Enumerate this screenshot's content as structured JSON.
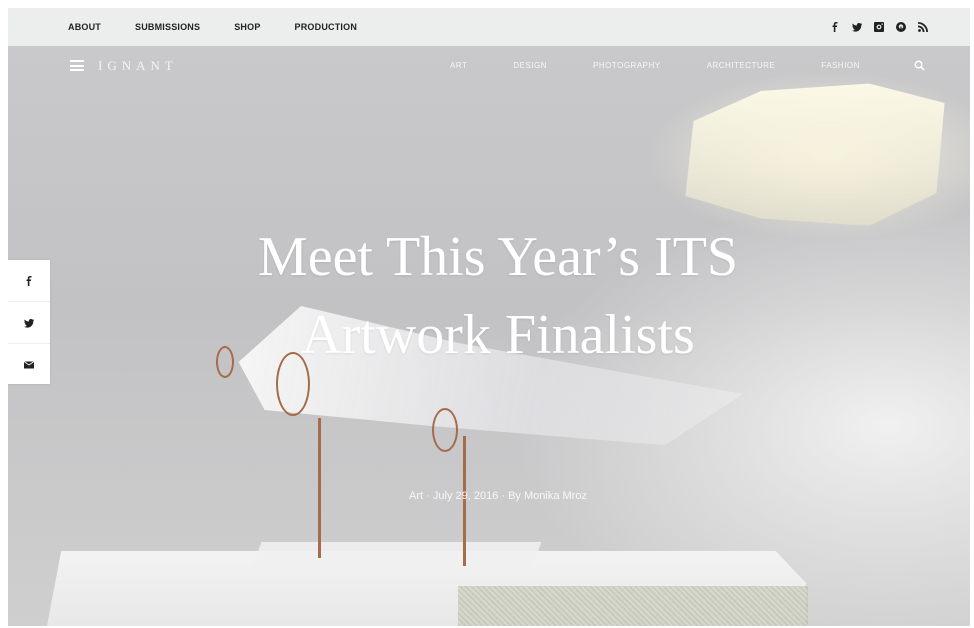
{
  "topbar": {
    "nav": [
      "ABOUT",
      "SUBMISSIONS",
      "SHOP",
      "PRODUCTION"
    ],
    "social_icons": [
      "facebook-icon",
      "twitter-icon",
      "instagram-icon",
      "pinterest-icon",
      "rss-icon"
    ]
  },
  "header": {
    "logo": "IGNANT",
    "categories": [
      "ART",
      "DESIGN",
      "PHOTOGRAPHY",
      "ARCHITECTURE",
      "FASHION"
    ],
    "search_icon": "search-icon",
    "menu_icon": "hamburger-icon"
  },
  "article": {
    "title": "Meet This Year’s ITS Artwork Finalists",
    "meta": "Art · July 29, 2016 · By Monika Mroz"
  },
  "share": {
    "icons": [
      "facebook-icon",
      "twitter-icon",
      "email-icon"
    ]
  },
  "colors": {
    "topbar_bg": "#eceded",
    "hero_bg": "#c6c6c8",
    "text_light": "#ffffff",
    "rod_copper": "#a56b4a"
  }
}
